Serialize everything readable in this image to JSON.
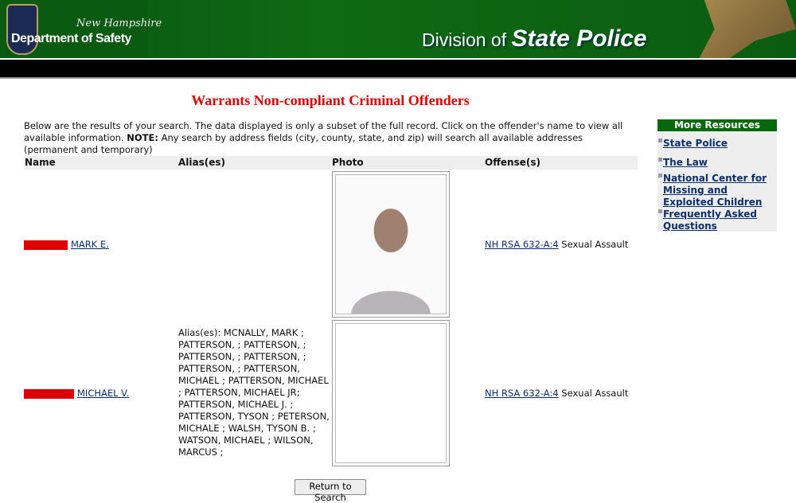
{
  "header": {
    "state": "New Hampshire",
    "department": "Department of Safety",
    "division_prefix": "Division of",
    "division_name": "State Police"
  },
  "title": "Warrants Non-compliant Criminal Offenders",
  "intro": {
    "text": "Below are the results of your search. The data displayed is only a subset of the full record. Click on the offender's name to view all available information.",
    "note_label": "NOTE:",
    "note_text": "Any search by address fields (city, county, state, and zip) will search all available addresses (permanent and temporary)"
  },
  "table": {
    "columns": [
      "Name",
      "Alias(es)",
      "Photo",
      "Offense(s)"
    ],
    "rows": [
      {
        "name": "MARK E.",
        "alias": "",
        "offense_link": "NH RSA 632-A:4",
        "offense_text": "Sexual Assault"
      },
      {
        "name": "MICHAEL V.",
        "alias": "Alias(es): MCNALLY, MARK ; PATTERSON, ; PATTERSON, ; PATTERSON, ; PATTERSON, ; PATTERSON, ; PATTERSON, MICHAEL ; PATTERSON, MICHAEL ; PATTERSON, MICHAEL JR; PATTERSON, MICHAEL J. ; PATTERSON, TYSON ; PETERSON, MICHALE ; WALSH, TYSON B. ; WATSON, MICHAEL ; WILSON, MARCUS ;",
        "offense_link": "NH RSA 632-A:4",
        "offense_text": "Sexual Assault"
      }
    ]
  },
  "return_button": "Return to Search",
  "sidebar": {
    "title": "More Resources",
    "items": [
      "State Police",
      "The Law",
      "National Center for Missing and Exploited Children",
      "Frequently Asked Questions"
    ]
  },
  "colors": {
    "brand_green": "#0b5e12",
    "title_red": "#dd0000",
    "link": "#0b2f6b"
  }
}
